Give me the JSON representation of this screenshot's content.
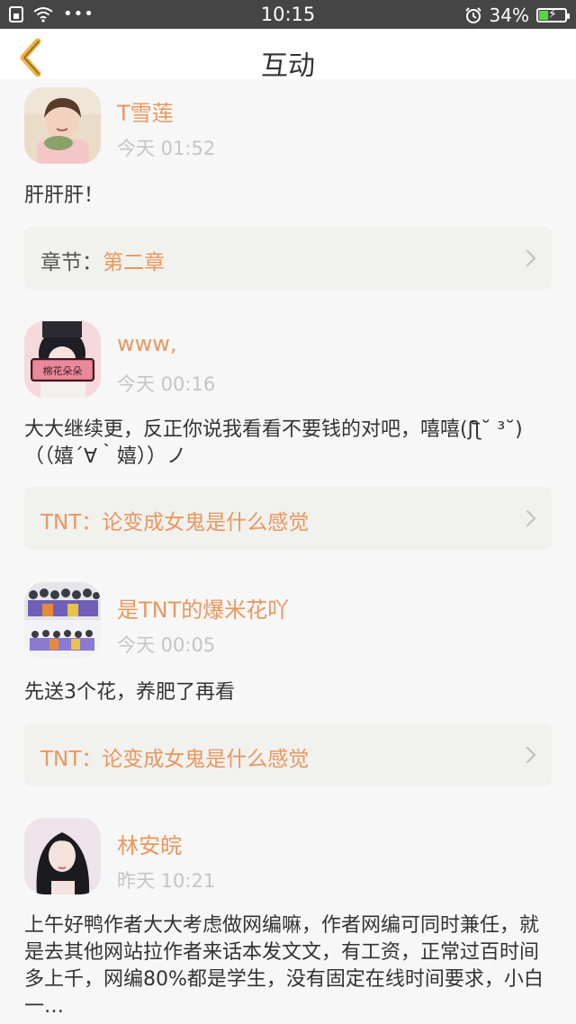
{
  "status_bar": {
    "time": "10:15",
    "battery": "34%",
    "battery_level": 0.34,
    "left_icons": [
      "sim-icon",
      "wifi-icon",
      "more-dots-icon"
    ],
    "right_icons": [
      "alarm-icon",
      "battery-charging-icon"
    ]
  },
  "header": {
    "title": "互动",
    "back_icon": "chevron-left-icon",
    "accent": "#f2b33d"
  },
  "comments": [
    {
      "user": "T雪莲",
      "time": "今天 01:52",
      "text": "肝肝肝！",
      "link_prefix": "章节：",
      "link_value": "第二章"
    },
    {
      "user": "www,",
      "time": "今天 00:16",
      "text": "大大继续更，反正你说我看看不要钱的对吧，嘻嘻(ʃƪ˘ ³˘)（（嬉´∀｀嬉））ノ",
      "link_prefix": "",
      "link_value": "TNT：论变成女鬼是什么感觉",
      "avatar_label": "棉花朵朵"
    },
    {
      "user": "是TNT的爆米花吖",
      "time": "今天 00:05",
      "text": "先送3个花，养肥了再看",
      "link_prefix": "",
      "link_value": "TNT：论变成女鬼是什么感觉"
    },
    {
      "user": "林安皖",
      "time": "昨天 10:21",
      "text": "上午好鸭作者大大考虑做网编嘛，作者网编可同时兼任，就是去其他网站拉作者来话本发文文，有工资，正常过百时间多上千，网编80%都是学生，没有固定在线时间要求，小白一…"
    }
  ],
  "colors": {
    "username": "#e9975e",
    "time": "#c5c5c5",
    "card_bg": "#f1f1ee",
    "page_bg": "#f7f7f7",
    "status_bg": "#454545"
  }
}
